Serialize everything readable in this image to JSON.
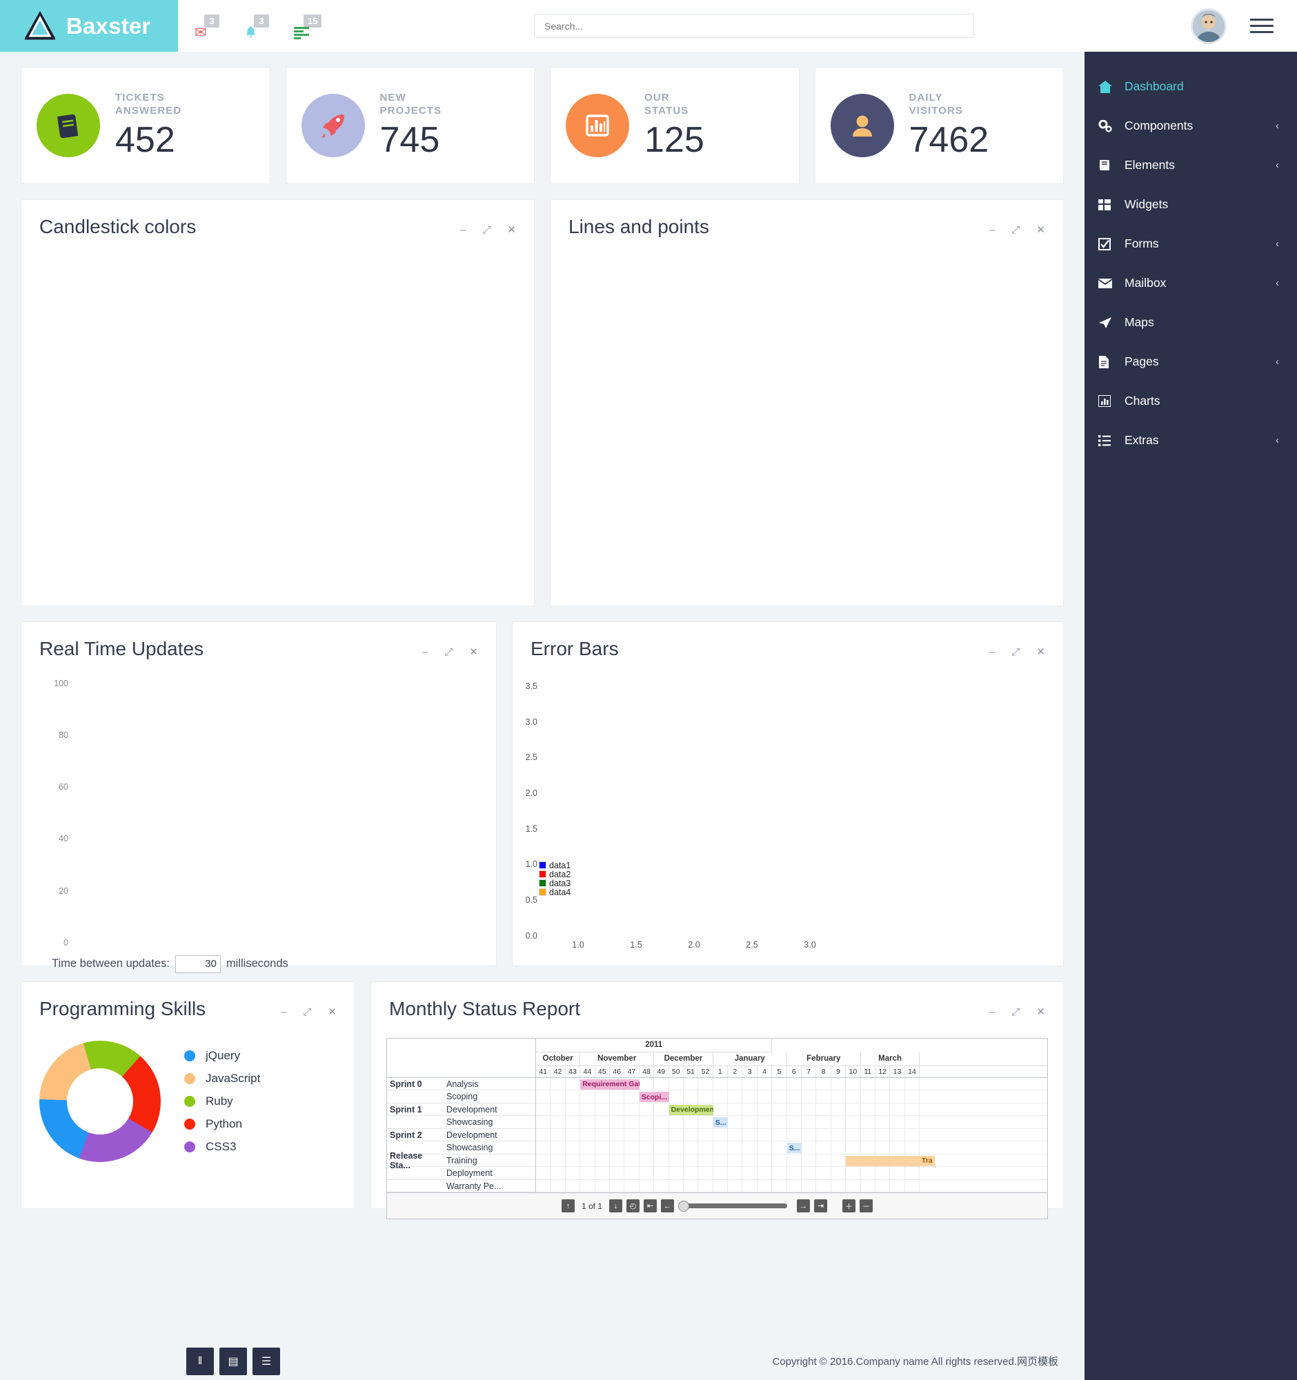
{
  "header": {
    "brand": "Baxster",
    "logo_icon": "triangle-logo",
    "icons": [
      {
        "name": "mail-icon",
        "glyph": "✉",
        "color": "#ee5a5f",
        "badge": "3"
      },
      {
        "name": "bell-icon",
        "glyph": "🔔",
        "color": "#6fd7e0",
        "badge": "3"
      },
      {
        "name": "list-icon",
        "glyph": "☲",
        "color": "#3aa757",
        "badge": "15"
      }
    ],
    "search": {
      "placeholder": "Search...",
      "value": ""
    },
    "avatar_name": "user-avatar",
    "menu_toggle": "hamburger-menu"
  },
  "sidebar": {
    "items": [
      {
        "label": "Dashboard",
        "icon": "home-icon",
        "glyph": "⌂",
        "caret": "",
        "active": true
      },
      {
        "label": "Components",
        "icon": "gears-icon",
        "glyph": "⚙",
        "caret": "‹",
        "active": false
      },
      {
        "label": "Elements",
        "icon": "book-icon",
        "glyph": "❐",
        "caret": "‹",
        "active": false
      },
      {
        "label": "Widgets",
        "icon": "grid-icon",
        "glyph": "▦",
        "caret": "",
        "active": false
      },
      {
        "label": "Forms",
        "icon": "checkbox-icon",
        "glyph": "☑",
        "caret": "‹",
        "active": false
      },
      {
        "label": "Mailbox",
        "icon": "envelope-icon",
        "glyph": "✉",
        "caret": "‹",
        "active": false
      },
      {
        "label": "Maps",
        "icon": "location-icon",
        "glyph": "➤",
        "caret": "",
        "active": false
      },
      {
        "label": "Pages",
        "icon": "page-icon",
        "glyph": "Ὄ4",
        "caret": "‹",
        "active": false
      },
      {
        "label": "Charts",
        "icon": "bar-chart-icon",
        "glyph": "█",
        "caret": "",
        "active": false
      },
      {
        "label": "Extras",
        "icon": "list-icon",
        "glyph": "☰",
        "caret": "‹",
        "active": false
      }
    ]
  },
  "stats": [
    {
      "label_line1": "TICKETS",
      "label_line2": "ANSWERED",
      "value": "452",
      "circle_color": "#8bc715",
      "icon": "book-icon",
      "icon_color": "#2b3148"
    },
    {
      "label_line1": "NEW",
      "label_line2": "PROJECTS",
      "value": "745",
      "circle_color": "#b3bbe3",
      "icon": "rocket-icon",
      "icon_color": "#ee5a5f"
    },
    {
      "label_line1": "OUR",
      "label_line2": "STATUS",
      "value": "125",
      "circle_color": "#f98c4b",
      "icon": "bar-chart-icon",
      "icon_color": "#ffffff"
    },
    {
      "label_line1": "DAILY",
      "label_line2": "VISITORS",
      "value": "7462",
      "circle_color": "#4b4f73",
      "icon": "user-icon",
      "icon_color": "#fcbe70"
    }
  ],
  "panels": {
    "candlestick": {
      "title": "Candlestick colors"
    },
    "lines_points": {
      "title": "Lines and points"
    },
    "real_time": {
      "title": "Real Time Updates"
    },
    "error_bars": {
      "title": "Error Bars"
    },
    "skills": {
      "title": "Programming Skills"
    },
    "status_report": {
      "title": "Monthly Status Report"
    },
    "tools": {
      "minimize": "–",
      "expand": "⤢",
      "close": "✕"
    }
  },
  "chart_data": [
    {
      "id": "candlestick",
      "type": "line",
      "title": "Candlestick colors",
      "note": "plot area empty / not rendered",
      "series": []
    },
    {
      "id": "lines_points",
      "type": "line",
      "title": "Lines and points",
      "note": "plot area empty / not rendered",
      "series": []
    },
    {
      "id": "real_time",
      "type": "line",
      "title": "Real Time Updates",
      "ylabel": "",
      "xlabel": "",
      "yticks": [
        100,
        80,
        60,
        40,
        20,
        0
      ],
      "ylim": [
        0,
        100
      ],
      "grid": false,
      "series": [],
      "controls": {
        "label": "Time between updates:",
        "value": "30",
        "unit": "milliseconds"
      }
    },
    {
      "id": "error_bars",
      "type": "scatter",
      "title": "Error Bars",
      "yticks": [
        "0.0",
        "0.5",
        "1.0",
        "1.5",
        "2.0",
        "2.5",
        "3.0",
        "3.5"
      ],
      "ylim": [
        0,
        3.5
      ],
      "xticks": [
        "1.0",
        "1.5",
        "2.0",
        "2.5",
        "3.0"
      ],
      "xlim": [
        0.75,
        3.25
      ],
      "grid": false,
      "legend_position": "bottom-left",
      "series": [
        {
          "name": "data1",
          "color": "#0000ff",
          "values": []
        },
        {
          "name": "data2",
          "color": "#ff0000",
          "values": []
        },
        {
          "name": "data3",
          "color": "#007a00",
          "values": []
        },
        {
          "name": "data4",
          "color": "#ffa516",
          "values": []
        }
      ]
    },
    {
      "id": "skills",
      "type": "pie",
      "title": "Programming Skills",
      "legend_position": "right",
      "labels": [
        "jQuery",
        "JavaScript",
        "Ruby",
        "Python",
        "CSS3"
      ],
      "colors": [
        "#2196f3",
        "#fcc07c",
        "#8bc715",
        "#f5240a",
        "#9b59d0"
      ],
      "values": [
        20,
        20,
        16,
        22,
        22
      ]
    },
    {
      "id": "status_report",
      "type": "table",
      "title": "Monthly Status Report",
      "year": "2011",
      "months": [
        {
          "name": "October",
          "weeks": [
            "41",
            "42",
            "43"
          ]
        },
        {
          "name": "November",
          "weeks": [
            "44",
            "45",
            "46",
            "47",
            "48"
          ]
        },
        {
          "name": "December",
          "weeks": [
            "49",
            "50",
            "51",
            "52"
          ]
        },
        {
          "name": "January",
          "weeks": [
            "1",
            "2",
            "3",
            "4",
            "5"
          ]
        },
        {
          "name": "February",
          "weeks": [
            "6",
            "7",
            "8",
            "9",
            "10"
          ]
        },
        {
          "name": "March",
          "weeks": [
            "11",
            "12",
            "13",
            "14"
          ]
        }
      ],
      "rows": [
        {
          "group": "Sprint 0",
          "task": "Analysis",
          "bar": {
            "label": "Requirement Gat...",
            "start": 3,
            "span": 4,
            "bg": "#f0b8d8",
            "fg": "#a01a61"
          }
        },
        {
          "group": "",
          "task": "Scoping",
          "bar": {
            "label": "Scopi...",
            "start": 7,
            "span": 2,
            "bg": "#f0b8d8",
            "fg": "#a01a61"
          }
        },
        {
          "group": "Sprint 1",
          "task": "Development",
          "bar": {
            "label": "Development",
            "start": 9,
            "span": 3,
            "bg": "#cce38a",
            "fg": "#4b6b10"
          }
        },
        {
          "group": "",
          "task": "Showcasing",
          "bar": {
            "label": "S...",
            "start": 12,
            "span": 1,
            "bg": "#cfe4f7",
            "fg": "#1c5a91"
          }
        },
        {
          "group": "Sprint 2",
          "task": "Development",
          "bar": null
        },
        {
          "group": "",
          "task": "Showcasing",
          "bar": {
            "label": "S...",
            "start": 17,
            "span": 1,
            "bg": "#cfe4f7",
            "fg": "#1c5a91"
          }
        },
        {
          "group": "Release Sta...",
          "task": "Training",
          "bar": {
            "label": "Tra",
            "start": 21,
            "span": 6,
            "bg": "#fbd3a0",
            "fg": "#9a5a0c"
          }
        },
        {
          "group": "",
          "task": "Deployment",
          "bar": null
        },
        {
          "group": "",
          "task": "Warranty Pe...",
          "bar": null
        }
      ],
      "toolbar": {
        "page_text": "1 of 1",
        "buttons": [
          "↑",
          "↓",
          "◴",
          "⇤",
          "←",
          "→",
          "⇥",
          "＋",
          "－"
        ]
      }
    }
  ],
  "footer": {
    "tools": [
      {
        "name": "pause-button",
        "glyph": "‖"
      },
      {
        "name": "chart-button",
        "glyph": "▤"
      },
      {
        "name": "doc-button",
        "glyph": "☰"
      }
    ],
    "copyright": "Copyright © 2016.Company name All rights reserved.网页模板"
  },
  "colors": {
    "brand": "#6fd7e0",
    "sidebar_bg": "#2b3148",
    "page_bg": "#f1f4f7",
    "active_nav": "#4ecfdc"
  }
}
